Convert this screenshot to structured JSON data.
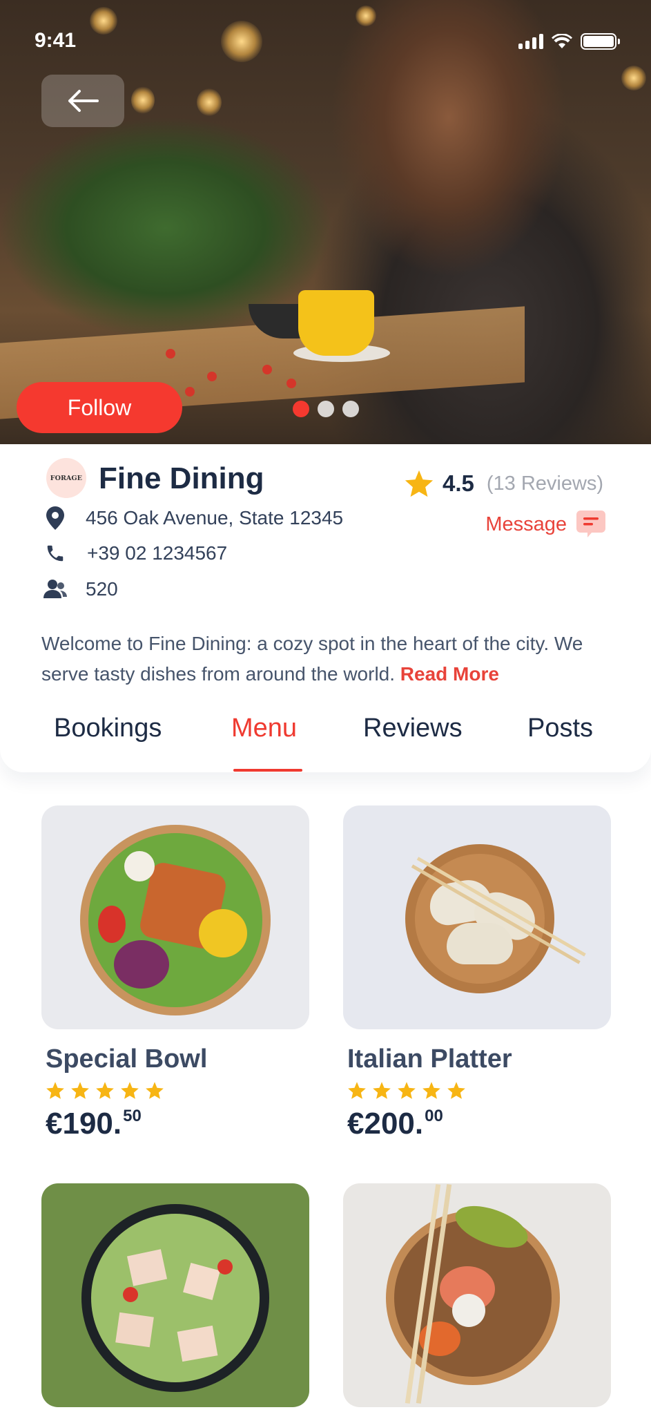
{
  "status_bar": {
    "time": "9:41"
  },
  "hero": {
    "follow_label": "Follow",
    "carousel_total": 3,
    "carousel_active": 1
  },
  "restaurant": {
    "logo_text": "FORAGE",
    "name": "Fine Dining",
    "rating": "4.5",
    "reviews": "(13 Reviews)",
    "address": "456 Oak Avenue, State 12345",
    "phone": "+39 02 1234567",
    "followers": "520",
    "message_label": "Message",
    "description": "Welcome to Fine Dining: a cozy spot in the heart of the city. We serve tasty dishes from around the world.",
    "read_more": "Read More"
  },
  "tabs": [
    {
      "label": "Bookings",
      "active": false
    },
    {
      "label": "Menu",
      "active": true
    },
    {
      "label": "Reviews",
      "active": false
    },
    {
      "label": "Posts",
      "active": false
    }
  ],
  "menu": [
    {
      "name": "Special Bowl",
      "price_main": "€190.",
      "price_cents": "50",
      "stars": 5
    },
    {
      "name": "Italian Platter",
      "price_main": "€200.",
      "price_cents": "00",
      "stars": 5
    },
    {
      "name": "",
      "price_main": "",
      "price_cents": ""
    },
    {
      "name": "",
      "price_main": "",
      "price_cents": ""
    }
  ],
  "colors": {
    "accent": "#f5392f",
    "star": "#f7b514",
    "text": "#1d2b44"
  },
  "icons": [
    "back-arrow-icon",
    "location-pin-icon",
    "phone-icon",
    "users-icon",
    "star-icon",
    "chat-icon",
    "signal-icon",
    "wifi-icon",
    "battery-icon"
  ]
}
